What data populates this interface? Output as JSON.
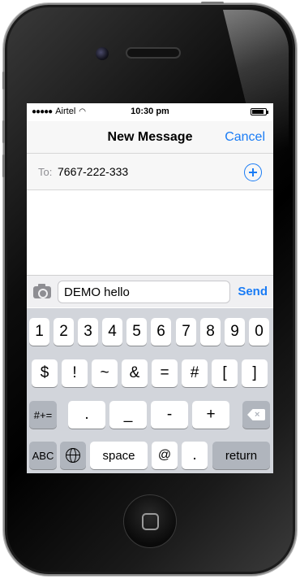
{
  "status": {
    "carrier": "Airtel",
    "time": "10:30 pm",
    "signal_dots": "●●●●●",
    "battery_fraction": 0.85
  },
  "nav": {
    "title": "New Message",
    "cancel_label": "Cancel"
  },
  "recipient": {
    "label": "To:",
    "value": "7667-222-333",
    "add_icon": "plus-circle-icon"
  },
  "compose": {
    "camera_icon": "camera-icon",
    "text": "DEMO hello",
    "send_label": "Send"
  },
  "keyboard": {
    "row1": [
      "1",
      "2",
      "3",
      "4",
      "5",
      "6",
      "7",
      "8",
      "9",
      "0"
    ],
    "row2": [
      "$",
      "!",
      "~",
      "&",
      "=",
      "#",
      "[",
      "]"
    ],
    "row3": {
      "shift_label": "#+=",
      "keys": [
        ".",
        "_",
        "-",
        "+"
      ],
      "backspace_icon": "backspace-icon"
    },
    "row4": {
      "abc_label": "ABC",
      "globe_icon": "globe-icon",
      "space_label": "space",
      "at_label": "@",
      "dot_label": ".",
      "return_label": "return"
    }
  },
  "colors": {
    "accent": "#1a7cf5",
    "keyboard_bg": "#d2d5db",
    "key_dark": "#b0b5bd"
  }
}
